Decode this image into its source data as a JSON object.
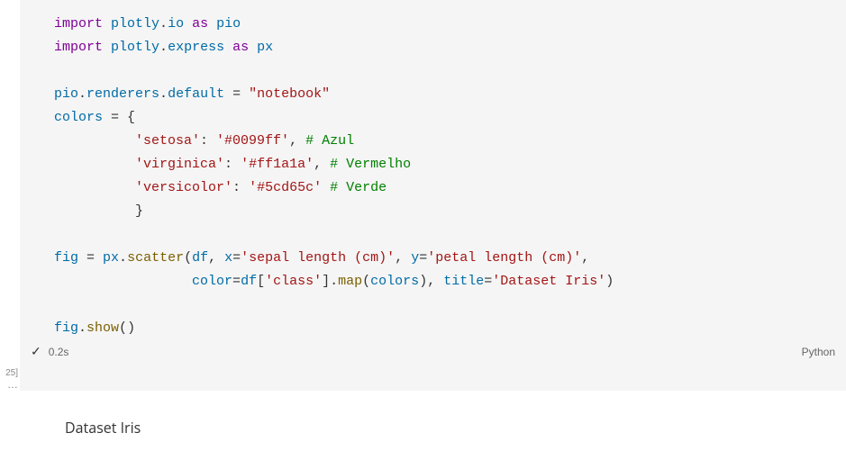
{
  "cell": {
    "execution_count": "25]",
    "lines": {
      "l1": {
        "kw1": "import",
        "mod1": "plotly",
        "dot1": ".",
        "mod2": "io",
        "kw2": "as",
        "alias": "pio"
      },
      "l2": {
        "kw1": "import",
        "mod1": "plotly",
        "dot1": ".",
        "mod2": "express",
        "kw2": "as",
        "alias": "px"
      },
      "l4": {
        "obj": "pio",
        "d1": ".",
        "attr1": "renderers",
        "d2": ".",
        "attr2": "default",
        "eq": " = ",
        "str": "\"notebook\""
      },
      "l5": {
        "var": "colors",
        "eq": " = ",
        "brace": "{"
      },
      "l6": {
        "key": "'setosa'",
        "colon": ": ",
        "val": "'#0099ff'",
        "comma": ",",
        "com": " # Azul"
      },
      "l7": {
        "key": "'virginica'",
        "colon": ": ",
        "val": "'#ff1a1a'",
        "comma": ",",
        "com": " # Vermelho"
      },
      "l8": {
        "key": "'versicolor'",
        "colon": ": ",
        "val": "'#5cd65c'",
        "com": " # Verde"
      },
      "l9": {
        "brace": "}"
      },
      "l11": {
        "var": "fig",
        "eq": " = ",
        "mod": "px",
        "d": ".",
        "fn": "scatter",
        "lp": "(",
        "arg1": "df",
        "c1": ", ",
        "kw1": "x",
        "e1": "=",
        "s1": "'sepal length (cm)'",
        "c2": ", ",
        "kw2": "y",
        "e2": "=",
        "s2": "'petal length (cm)'",
        "c3": ","
      },
      "l12": {
        "kw1": "color",
        "e1": "=",
        "obj": "df",
        "lb": "[",
        "key": "'class'",
        "rb": "]",
        "d": ".",
        "fn": "map",
        "lp": "(",
        "arg": "colors",
        "rp": ")",
        "c1": ", ",
        "kw2": "title",
        "e2": "=",
        "s1": "'Dataset Iris'",
        "rp2": ")"
      },
      "l14": {
        "obj": "fig",
        "d": ".",
        "fn": "show",
        "lp": "(",
        "rp": ")"
      }
    },
    "status": {
      "check": "✓",
      "duration": "0.2s",
      "lang": "Python"
    },
    "ellipsis": "…"
  },
  "output": {
    "title": "Dataset Iris"
  }
}
